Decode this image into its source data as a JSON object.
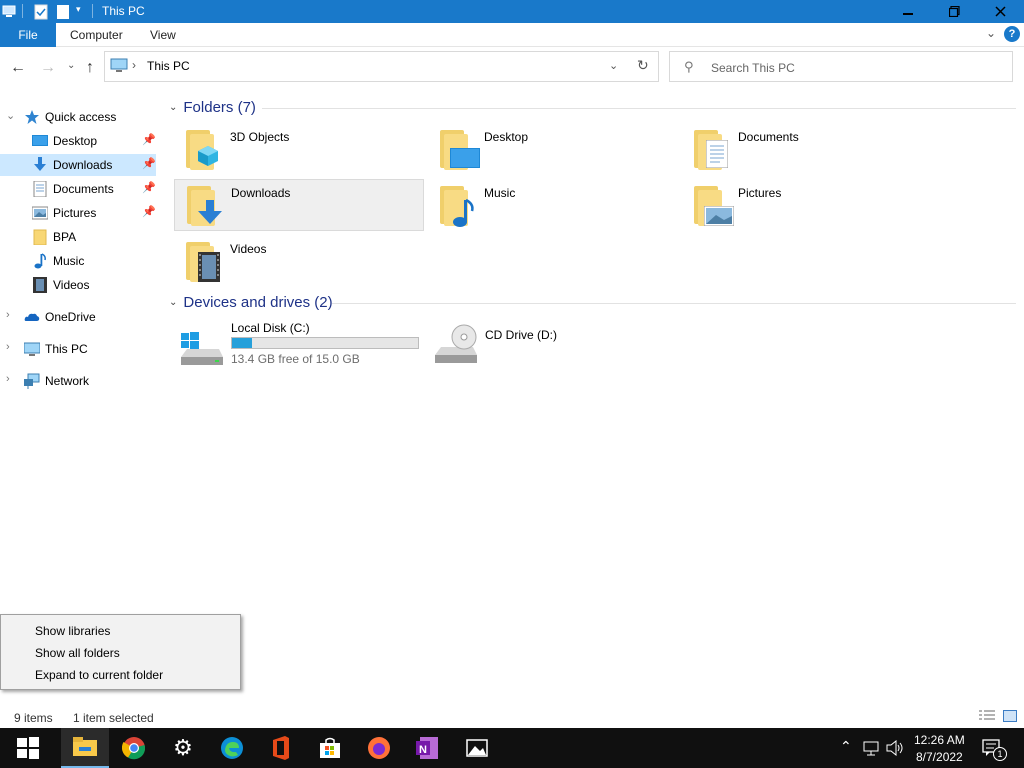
{
  "window": {
    "title": "This PC"
  },
  "colors": {
    "accent": "#1979ca",
    "selection": "#cce8ff",
    "group_header": "#1e3287",
    "disk_fill": "#26a0da",
    "taskbar": "#101010"
  },
  "ribbon": {
    "tabs": [
      {
        "label": "File"
      },
      {
        "label": "Computer"
      },
      {
        "label": "View"
      }
    ],
    "help_label": "?"
  },
  "address_bar": {
    "path": "This PC"
  },
  "search": {
    "placeholder": "Search This PC"
  },
  "nav_pane": {
    "quick_access": "Quick access",
    "items": [
      {
        "label": "Desktop",
        "icon": "desktop-icon"
      },
      {
        "label": "Downloads",
        "icon": "downloads-icon"
      },
      {
        "label": "Documents",
        "icon": "documents-icon"
      },
      {
        "label": "Pictures",
        "icon": "pictures-icon"
      },
      {
        "label": "BPA",
        "icon": "folder-icon"
      },
      {
        "label": "Music",
        "icon": "music-icon"
      },
      {
        "label": "Videos",
        "icon": "videos-icon"
      }
    ],
    "onedrive": "OneDrive",
    "this_pc": "This PC",
    "network": "Network"
  },
  "content": {
    "folders_header": "Folders (7)",
    "folders": [
      {
        "label": "3D Objects"
      },
      {
        "label": "Desktop"
      },
      {
        "label": "Documents"
      },
      {
        "label": "Downloads"
      },
      {
        "label": "Music"
      },
      {
        "label": "Pictures"
      },
      {
        "label": "Videos"
      }
    ],
    "devices_header": "Devices and drives (2)",
    "drives": [
      {
        "label": "Local Disk (C:)",
        "free_text": "13.4 GB free of 15.0 GB",
        "used_fraction": 0.107
      },
      {
        "label": "CD Drive (D:)"
      }
    ]
  },
  "context_menu": {
    "items": [
      {
        "label": "Show libraries"
      },
      {
        "label": "Show all folders"
      },
      {
        "label": "Expand to current folder"
      }
    ]
  },
  "status_bar": {
    "item_count": "9 items",
    "selected": "1 item selected"
  },
  "taskbar": {
    "icons": [
      "start-icon",
      "file-explorer-icon",
      "chrome-icon",
      "settings-icon",
      "edge-icon",
      "office-icon",
      "store-icon",
      "firefox-icon",
      "onenote-icon",
      "photos-icon"
    ],
    "clock_time": "12:26 AM",
    "clock_date": "8/7/2022",
    "notification_count": "1"
  }
}
